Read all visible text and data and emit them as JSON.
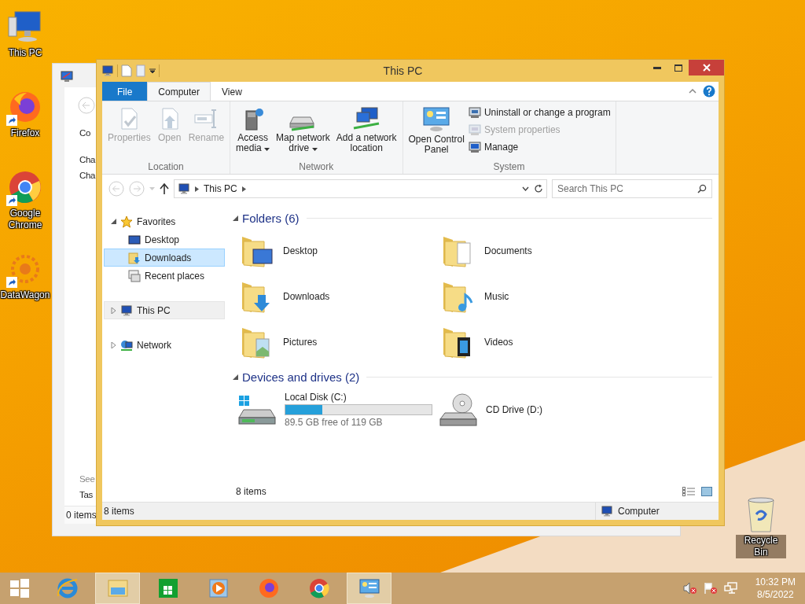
{
  "desktop_icons": [
    {
      "label": "This PC"
    },
    {
      "label": "Firefox"
    },
    {
      "label": "Google Chrome"
    },
    {
      "label": "DataWagon"
    },
    {
      "label": "Recycle Bin"
    }
  ],
  "back_window": {
    "upper_texts": [
      "Co",
      "Cha",
      "Cha"
    ],
    "lower_texts": [
      "See",
      "Tas"
    ],
    "status": "0 items"
  },
  "window": {
    "title": "This PC"
  },
  "ribbon_tabs": [
    {
      "label": "File",
      "kind": "file",
      "selected": false
    },
    {
      "label": "Computer",
      "kind": "tab",
      "selected": true
    },
    {
      "label": "View",
      "kind": "tab",
      "selected": false
    }
  ],
  "ribbon_groups": [
    {
      "label": "Location",
      "items": [
        {
          "label": "Properties",
          "kind": "large",
          "disabled": true,
          "dropdown": false
        },
        {
          "label": "Open",
          "kind": "large",
          "disabled": true,
          "dropdown": false
        },
        {
          "label": "Rename",
          "kind": "large",
          "disabled": true,
          "dropdown": false
        }
      ]
    },
    {
      "label": "Network",
      "items": [
        {
          "label": "Access\nmedia",
          "kind": "large",
          "disabled": false,
          "dropdown": true
        },
        {
          "label": "Map network\ndrive",
          "kind": "large",
          "disabled": false,
          "dropdown": true
        },
        {
          "label": "Add a network\nlocation",
          "kind": "large",
          "disabled": false,
          "dropdown": false
        }
      ]
    },
    {
      "label": "System",
      "items": [
        {
          "label": "Open Control\nPanel",
          "kind": "large",
          "disabled": false,
          "dropdown": false
        },
        {
          "label": "Uninstall or change a program",
          "kind": "small",
          "disabled": false
        },
        {
          "label": "System properties",
          "kind": "small",
          "disabled": true
        },
        {
          "label": "Manage",
          "kind": "small",
          "disabled": false
        }
      ]
    }
  ],
  "address_bar": {
    "crumbs": [
      "This PC"
    ]
  },
  "search": {
    "placeholder": "Search This PC"
  },
  "navigation_pane": [
    {
      "label": "Favorites",
      "expanded": true,
      "current": false,
      "children": [
        {
          "label": "Desktop",
          "selected": false
        },
        {
          "label": "Downloads",
          "selected": true
        },
        {
          "label": "Recent places",
          "selected": false
        }
      ]
    },
    {
      "label": "This PC",
      "expanded": false,
      "current": true
    },
    {
      "label": "Network",
      "expanded": false,
      "current": false
    }
  ],
  "sections": [
    {
      "title": "Folders (6)",
      "expanded": true,
      "items": [
        {
          "name": "Desktop",
          "kind": "folder"
        },
        {
          "name": "Documents",
          "kind": "folder"
        },
        {
          "name": "Downloads",
          "kind": "folder"
        },
        {
          "name": "Music",
          "kind": "folder"
        },
        {
          "name": "Pictures",
          "kind": "folder"
        },
        {
          "name": "Videos",
          "kind": "folder"
        }
      ]
    },
    {
      "title": "Devices and drives (2)",
      "expanded": true,
      "items": [
        {
          "name": "Local Disk (C:)",
          "kind": "disk",
          "level": 0.25,
          "detail": "89.5 GB free of 119 GB"
        },
        {
          "name": "CD Drive (D:)",
          "kind": "optical"
        }
      ]
    }
  ],
  "item_count": "8 items",
  "status_bar": {
    "count": "8 items",
    "location": "Computer"
  },
  "taskbar": {
    "apps": [
      {
        "active": false
      },
      {
        "active": true
      },
      {
        "active": false
      },
      {
        "active": false
      },
      {
        "active": false
      },
      {
        "active": false
      },
      {
        "active": true
      }
    ]
  },
  "tray": {
    "time": "10:32 PM",
    "date": "8/5/2022"
  }
}
